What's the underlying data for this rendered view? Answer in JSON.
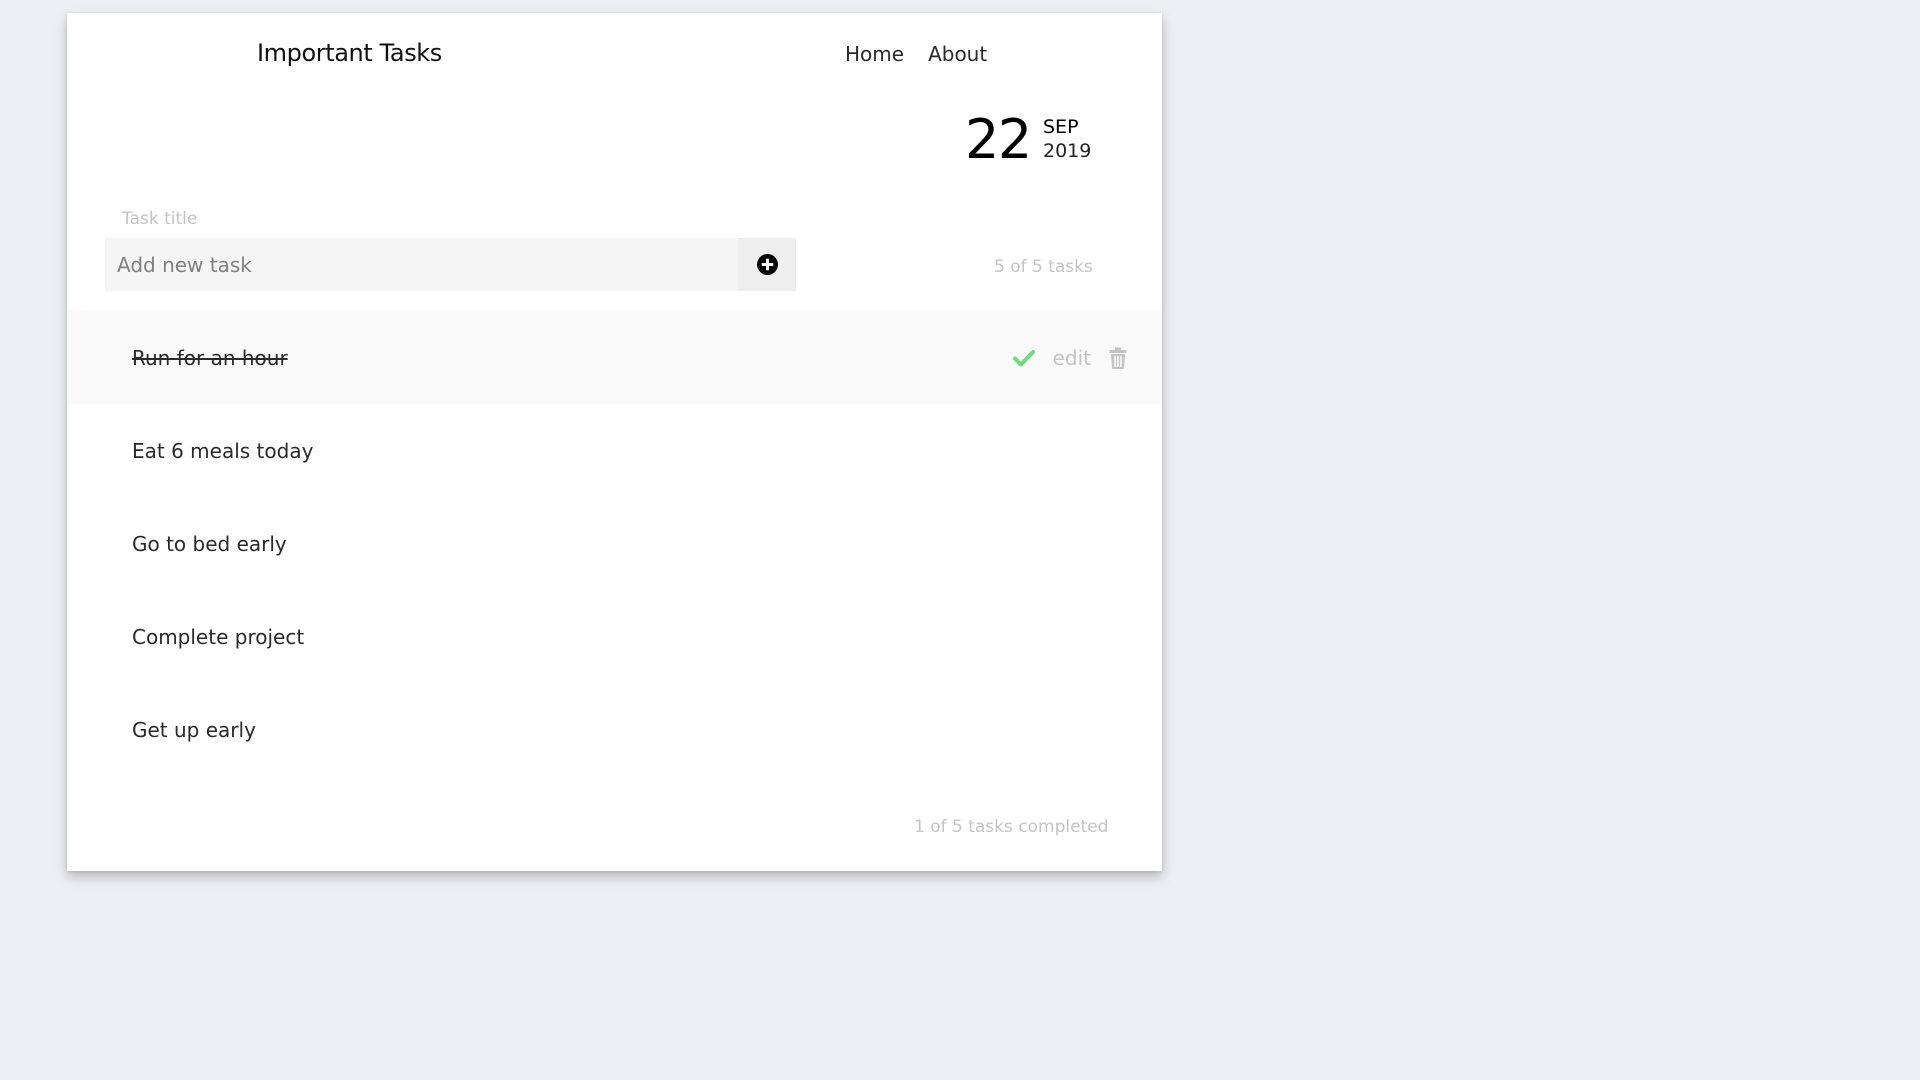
{
  "header": {
    "title": "Important Tasks",
    "nav": [
      {
        "label": "Home"
      },
      {
        "label": "About"
      }
    ]
  },
  "date": {
    "day": "22",
    "month": "SEP",
    "year": "2019"
  },
  "form": {
    "label": "Task title",
    "placeholder": "Add new task",
    "add_icon": "plus-circle-icon"
  },
  "task_count": "5 of 5 tasks",
  "tasks": [
    {
      "title": "Run for an hour",
      "completed": true
    },
    {
      "title": "Eat 6 meals today",
      "completed": false
    },
    {
      "title": "Go to bed early",
      "completed": false
    },
    {
      "title": "Complete project",
      "completed": false
    },
    {
      "title": "Get up early",
      "completed": false
    }
  ],
  "row_actions": {
    "edit_label": "edit",
    "complete_icon": "check-icon",
    "delete_icon": "trash-icon",
    "check_color": "#6edb7d",
    "muted_color": "#c4c4c4"
  },
  "summary": "1 of 5 tasks completed"
}
